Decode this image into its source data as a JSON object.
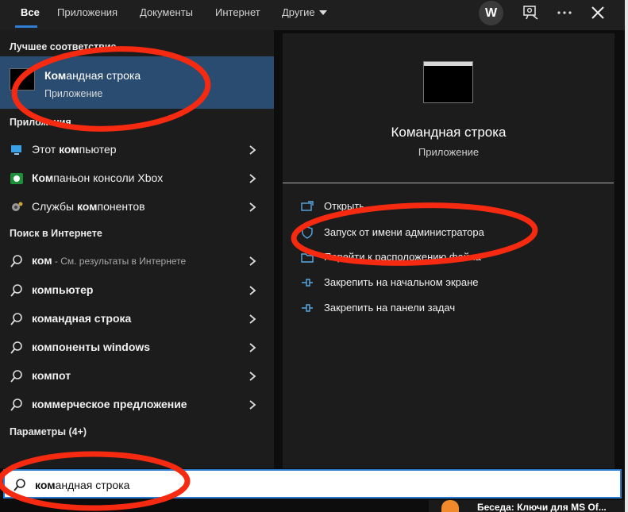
{
  "tabs": [
    {
      "label": "Все",
      "active": true
    },
    {
      "label": "Приложения"
    },
    {
      "label": "Документы"
    },
    {
      "label": "Интернет"
    },
    {
      "label": "Другие"
    }
  ],
  "account": {
    "initial": "W"
  },
  "best_match": {
    "header": "Лучшее соответствие",
    "title_bold": "Ком",
    "title_rest": "андная строка",
    "subtitle": "Приложение"
  },
  "apps": {
    "header": "Приложения",
    "items": [
      {
        "pre": "Этот ",
        "bold": "ком",
        "post": "пьютер",
        "icon": "this-pc-icon"
      },
      {
        "pre": "",
        "bold": "Ком",
        "post": "паньон консоли Xbox",
        "icon": "xbox-icon"
      },
      {
        "pre": "Службы ",
        "bold": "ком",
        "post": "понентов",
        "icon": "component-services-icon"
      }
    ]
  },
  "web": {
    "header": "Поиск в Интернете",
    "first": {
      "bold": "ком",
      "suffix": " - См. результаты в Интернете"
    },
    "items": [
      "компьютер",
      "командная строка",
      "компоненты windows",
      "компот",
      "коммерческое предложение"
    ]
  },
  "settings": {
    "header": "Параметры (4+)"
  },
  "preview": {
    "title": "Командная строка",
    "subtitle": "Приложение",
    "actions": [
      {
        "label": "Открыть",
        "icon": "open-icon"
      },
      {
        "label": "Запуск от имени администратора",
        "icon": "shield-admin-icon"
      },
      {
        "label": "Перейти к расположению файла",
        "icon": "folder-location-icon"
      },
      {
        "label": "Закрепить на начальном экране",
        "icon": "pin-start-icon"
      },
      {
        "label": "Закрепить на панели задач",
        "icon": "pin-taskbar-icon"
      }
    ]
  },
  "search": {
    "bold": "ком",
    "rest": "андная строка",
    "value": "командная строка"
  },
  "taskbar": {
    "peek_text": "Беседа: Ключи для MS Of..."
  },
  "colors": {
    "accent": "#2e7fd3",
    "selected_bg": "#2a4c71",
    "annotation": "#f52a10"
  }
}
